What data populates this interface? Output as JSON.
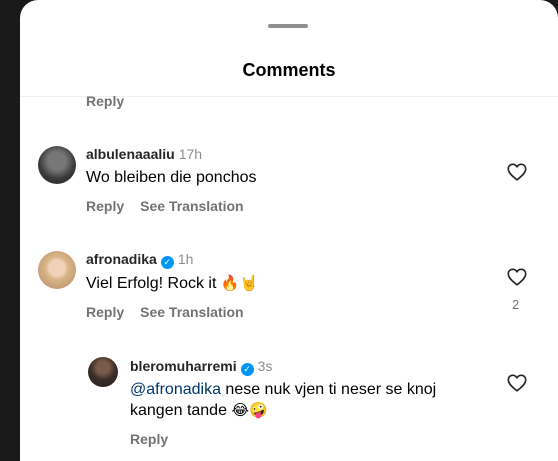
{
  "header": {
    "title": "Comments"
  },
  "cut_off_reply": "Reply",
  "comments": [
    {
      "username": "albulenaaaliu",
      "verified": false,
      "time": "17h",
      "text": "Wo bleiben die ponchos",
      "reply_label": "Reply",
      "translate_label": "See Translation",
      "like_count": ""
    },
    {
      "username": "afronadika",
      "verified": true,
      "time": "1h",
      "text": "Viel Erfolg! Rock it",
      "emojis": "🔥🤘",
      "reply_label": "Reply",
      "translate_label": "See Translation",
      "like_count": "2"
    },
    {
      "username": "bleromuharremi",
      "verified": true,
      "time": "3s",
      "mention": "@afronadika",
      "text_line1": " nese nuk vjen ti neser se knoj",
      "text_line2": "kangen tande",
      "emojis": "😂🤪",
      "reply_label": "Reply",
      "like_count": ""
    }
  ],
  "colors": {
    "accent": "#0095f6",
    "muted": "#737373",
    "mention": "#00376b"
  }
}
